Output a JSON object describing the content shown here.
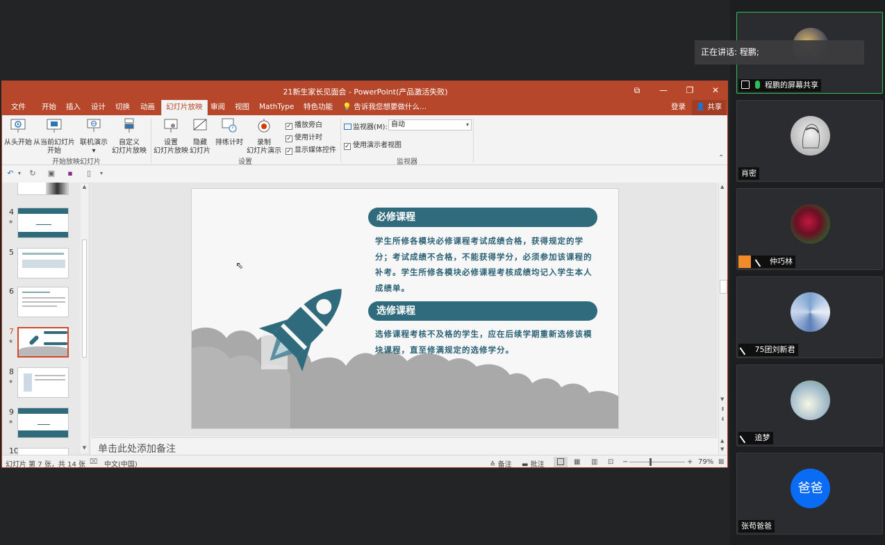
{
  "window": {
    "title": "21新生家长见面会 - PowerPoint(产品激活失败)",
    "login": "登录",
    "share": "共享"
  },
  "tabs": [
    "文件",
    "开始",
    "插入",
    "设计",
    "切换",
    "动画",
    "幻灯片放映",
    "审阅",
    "视图",
    "MathType",
    "特色功能"
  ],
  "tell_me": "告诉我您想要做什么...",
  "ribbon": {
    "from_start": "从头开始",
    "from_current_1": "从当前幻灯片",
    "from_current_2": "开始",
    "online": "联机演示",
    "custom_1": "自定义",
    "custom_2": "幻灯片放映",
    "group_start": "开始放映幻灯片",
    "setup_1": "设置",
    "setup_2": "幻灯片放映",
    "hide_1": "隐藏",
    "hide_2": "幻灯片",
    "rehearse": "排练计时",
    "record_1": "录制",
    "record_2": "幻灯片演示",
    "play_narration": "播放旁白",
    "use_timings": "使用计时",
    "show_media": "显示媒体控件",
    "group_setup": "设置",
    "monitor_label": "监视器(M):",
    "monitor_value": "自动",
    "presenter_view": "使用演示者视图",
    "group_monitor": "监视器"
  },
  "thumbnails": [
    {
      "num": "4",
      "sel": false
    },
    {
      "num": "5",
      "sel": false
    },
    {
      "num": "6",
      "sel": false
    },
    {
      "num": "7",
      "sel": true
    },
    {
      "num": "8",
      "sel": false
    },
    {
      "num": "9",
      "sel": false
    },
    {
      "num": "10",
      "sel": false
    }
  ],
  "slide": {
    "heading1": "必修课程",
    "para1": "学生所修各模块必修课程考试成绩合格，获得规定的学分；考试成绩不合格，不能获得学分，必须参加该课程的补考。学生所修各模块必修课程考核成绩均记入学生本人成绩单。",
    "heading2": "选修课程",
    "para2": "选修课程考核不及格的学生，应在后续学期重新选修该模块课程，直至修满规定的选修学分。"
  },
  "notes_placeholder": "单击此处添加备注",
  "status": {
    "slide_info": "幻灯片 第 7 张，共 14 张",
    "language": "中文(中国)",
    "notes": "备注",
    "comments": "批注",
    "zoom": "79%"
  },
  "meeting": {
    "speaking": "正在讲话: 程鹏;",
    "participants": [
      {
        "name": "程鹏的屏幕共享"
      },
      {
        "name": "肖密"
      },
      {
        "name": "仲巧林"
      },
      {
        "name": "75团刘新君"
      },
      {
        "name": "追梦"
      },
      {
        "name": "张苟爸爸",
        "avatar_text": "爸爸"
      }
    ]
  },
  "colors": {
    "ppt_accent": "#b7472a",
    "slide_teal": "#2f6b7d",
    "active_speaker": "#2fbd5a",
    "avatar_blue": "#0a6cf5"
  }
}
